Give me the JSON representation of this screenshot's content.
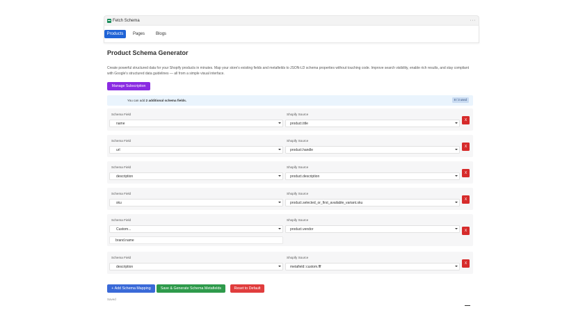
{
  "app": {
    "title": "Fetch Schema",
    "menu_icon": "ellipsis-icon",
    "tabs": [
      {
        "label": "Products",
        "active": true
      },
      {
        "label": "Pages",
        "active": false
      },
      {
        "label": "Blogs",
        "active": false
      }
    ]
  },
  "page": {
    "title": "Product Schema Generator",
    "description": "Create powerful structured data for your Shopify products in minutes. Map your store's existing fields and metafields to JSON-LD schema properties without touching code. Improve search visibility, enable rich results, and stay compliant with Google's structured data guidelines — all from a simple visual interface.",
    "manage_button": "Manage Subscription"
  },
  "banner": {
    "prefix": "You can add ",
    "highlight": "2 additional schema fields.",
    "usage": "8 / 3 used"
  },
  "labels": {
    "schema_field": "Schema Field",
    "shopify_source": "Shopify Source",
    "remove": "X"
  },
  "mappings": [
    {
      "schema_field": "name",
      "source": "product.title"
    },
    {
      "schema_field": "url",
      "source": "product.handle"
    },
    {
      "schema_field": "description",
      "source": "product.description"
    },
    {
      "schema_field": "sku",
      "source": "product.selected_or_first_available_variant.sku"
    },
    {
      "schema_field": "Custom...",
      "custom_value": "brand.name",
      "source": "product.vendor"
    },
    {
      "schema_field": "description",
      "source": "metafield::custom.fff"
    }
  ],
  "actions": {
    "add": "+ Add Schema Mapping",
    "save": "Save & Generate Schema Metafields",
    "reset": "Reset to Default"
  },
  "footer": {
    "note": "Saved"
  },
  "colors": {
    "primary": "#1f63d6",
    "manage": "#8a2be2",
    "save": "#2e9a4b",
    "danger": "#d62b2b",
    "banner_bg": "#eaf4fd"
  }
}
